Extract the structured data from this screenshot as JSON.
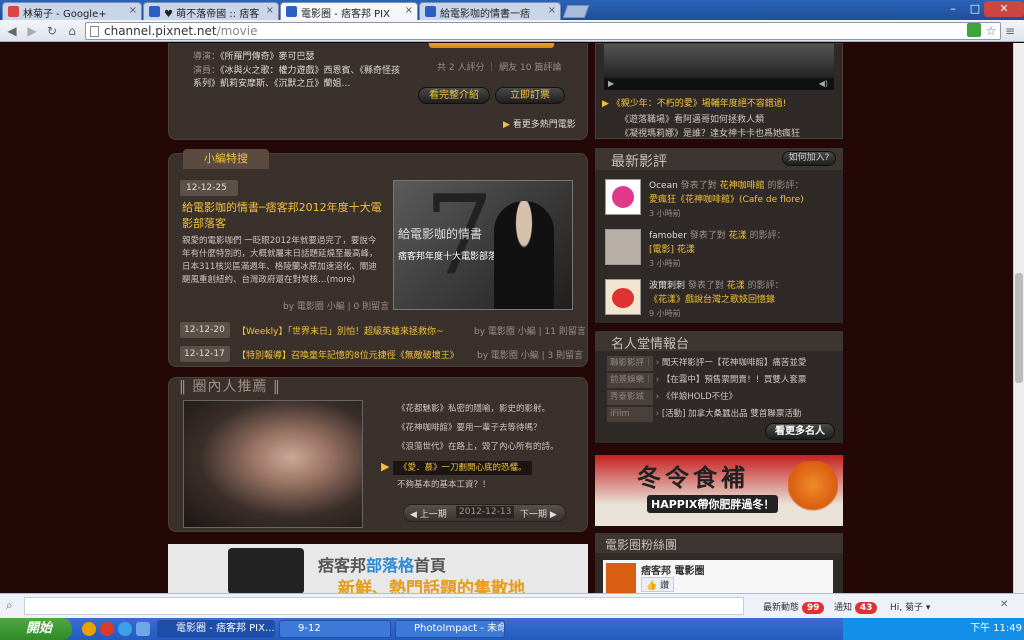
{
  "tabs": [
    {
      "label": "林菊子 - Google+",
      "color": "#d44"
    },
    {
      "label": "♥ 萌不落帝國 :: 痞客",
      "color": "#2b5fc4"
    },
    {
      "label": "電影圈 - 痞客邦 PIX",
      "color": "#2b5fc4"
    },
    {
      "label": "給電影咖的情書一痞",
      "color": "#2b5fc4"
    }
  ],
  "window": {
    "minimize": "–",
    "maximize": "□",
    "close": "✕"
  },
  "address": {
    "host": "channel.pixnet.net",
    "path": "/movie"
  },
  "movie_info": {
    "director_label": "導演：",
    "director": "《所羅門傳奇》麥可巴瑟",
    "cast_label": "演員：",
    "cast": "《冰與火之歌：權力遊戲》西恩賓、《縣奇怪孩系列》凱莉安摩斯、《沉默之丘》蘭姐…",
    "rating_text": "共 2 人評分 ｜ 網友 10 篇評論",
    "rating_count": "2",
    "review_count": "10",
    "btn_full": "看完整介紹",
    "btn_ticket": "立即訂票",
    "more_link": "看更多熱門電影"
  },
  "editor_pick": {
    "tab": "小編特搜",
    "date": "12-12-25",
    "title": "給電影咖的情書─痞客邦2012年度十大電影部落客",
    "excerpt": "親愛的電影咖們 一眨眼2012年就要過完了，要說今年有什麼特別的，大概就屬末日話題延燒至最高峰，日本311核災區滿週年、格陵蘭冰原加速溶化、閘迪颶風重創紐約、台灣政府還在對炭核…(more)",
    "byline": "by 電影圈 小編 | 0 則留言",
    "image_caption": "給電影咖的情書",
    "image_sub": "痞客邦年度十大電影部落客",
    "image_num": "7",
    "list": [
      {
        "date": "12-12-20",
        "title": "【Weekly】「世界末日」別怕！超級英雄來拯救你~",
        "byline": "by 電影圈 小編 | 11 則留言"
      },
      {
        "date": "12-12-17",
        "title": "【特別報導】召喚童年記憶的8位元捷徑《無敵破壞王》",
        "byline": "by 電影圈 小編 | 3 則留言"
      }
    ]
  },
  "insider": {
    "title": "圈內人推薦",
    "items": [
      "《花都魅影》私密的隱喻，影史的影射。",
      "《花神咖啡館》要用一輩子去等待嗎？",
      "《浪蕩世代》在路上，毀了內心所有的詩。",
      "《愛．慕》一刀劃開心底的恐懼。",
      "不夠基本的基本工資？！"
    ],
    "active_index": 3,
    "prev": "上一期",
    "date": "2012-12-13",
    "next": "下一期"
  },
  "banner_bottom": {
    "text1": "痞客邦",
    "text2": "部落格",
    "text3": "首頁",
    "text4": "新鮮、熱門話題的集散地"
  },
  "right_top": {
    "active": "《親少年：不朽的愛》場輔年度絕不容錯過!",
    "items": [
      "《遊落職場》看阿邁哥如何拯救人類",
      "《凝視瑪莉娜》是誰？達女神卡卡也爲她瘋狂"
    ]
  },
  "recent_reviews": {
    "title": "最新影評",
    "join": "如何加入?",
    "entries": [
      {
        "user": "Ocean",
        "verb": "發表了對",
        "target": "花神咖啡館",
        "suffix": "的影評：",
        "review": "愛瘋狂《花神咖啡館》(Cafe de flore)",
        "time": "3 小時前",
        "avatar": "#e0398c"
      },
      {
        "user": "famober",
        "verb": "發表了對",
        "target": "花漾",
        "suffix": "的影評：",
        "review": "[電影] 花漾",
        "time": "3 小時前",
        "avatar": "#555"
      },
      {
        "user": "波爾刺刺",
        "verb": "發表了對",
        "target": "花漾",
        "suffix": "的影評：",
        "review": "《花漾》戲說台灣之歌妓回憶錄",
        "time": "9 小時前",
        "avatar": "#d33"
      }
    ]
  },
  "hall_of_fame": {
    "title": "名人堂情報台",
    "rows": [
      {
        "tag": "聯影影評｜",
        "text": "聞天祥影評一【花神咖啡館】痛苦並愛"
      },
      {
        "tag": "前景娛樂｜",
        "text": "【在霧中】預售票開賣！！買雙人套票"
      },
      {
        "tag": "秀泰影城",
        "text": "《伴娘HOLD不住》"
      },
      {
        "tag": "iFilm",
        "text": "[活動] 加拿大桑蠶出品 雙首聯票活動"
      }
    ],
    "more": "看更多名人"
  },
  "ad_banner": {
    "title": "冬令食補",
    "sub": "HAPPIX帶你肥胖過冬！"
  },
  "fan_club": {
    "title": "電影圈粉絲團",
    "name": "痞客邦 電影圈",
    "like": "讚"
  },
  "bottom_bar": {
    "latest": "最新動態",
    "latest_count": "99",
    "notify": "通知",
    "notify_count": "43",
    "user": "Hi, 菊子"
  },
  "taskbar": {
    "start": "開始",
    "items": [
      "電影圈 - 痞客邦 PIX...",
      "9-12",
      "PhotoImpact - 未命名..."
    ],
    "clock": "下午 11:49"
  }
}
